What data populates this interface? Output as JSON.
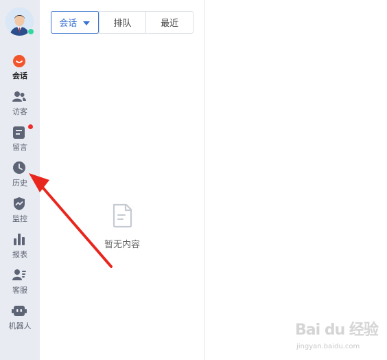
{
  "sidebar": {
    "items": [
      {
        "label": "会话",
        "icon": "chat-bubble-icon",
        "active": true,
        "badge": false
      },
      {
        "label": "访客",
        "icon": "visitors-icon",
        "active": false,
        "badge": false
      },
      {
        "label": "留言",
        "icon": "message-note-icon",
        "active": false,
        "badge": true
      },
      {
        "label": "历史",
        "icon": "clock-icon",
        "active": false,
        "badge": false
      },
      {
        "label": "监控",
        "icon": "shield-monitor-icon",
        "active": false,
        "badge": false
      },
      {
        "label": "报表",
        "icon": "bar-chart-icon",
        "active": false,
        "badge": false
      },
      {
        "label": "客服",
        "icon": "agent-icon",
        "active": false,
        "badge": false
      },
      {
        "label": "机器人",
        "icon": "robot-icon",
        "active": false,
        "badge": false
      }
    ]
  },
  "tabs": [
    {
      "label": "会话",
      "active": true,
      "dropdown": true
    },
    {
      "label": "排队",
      "active": false,
      "dropdown": false
    },
    {
      "label": "最近",
      "active": false,
      "dropdown": false
    }
  ],
  "empty_state": {
    "text": "暂无内容",
    "icon": "empty-document-icon"
  },
  "watermark": {
    "text": "Bai du 经验",
    "sub": "jingyan.baidu.com"
  },
  "colors": {
    "sidebar_bg": "#e8ebf1",
    "accent": "#3b73d1",
    "active_icon": "#f2552c",
    "icon_gray": "#5d6475",
    "badge_red": "#f02d2d",
    "online_green": "#33d6a0",
    "annotation_arrow": "#e8261d"
  }
}
